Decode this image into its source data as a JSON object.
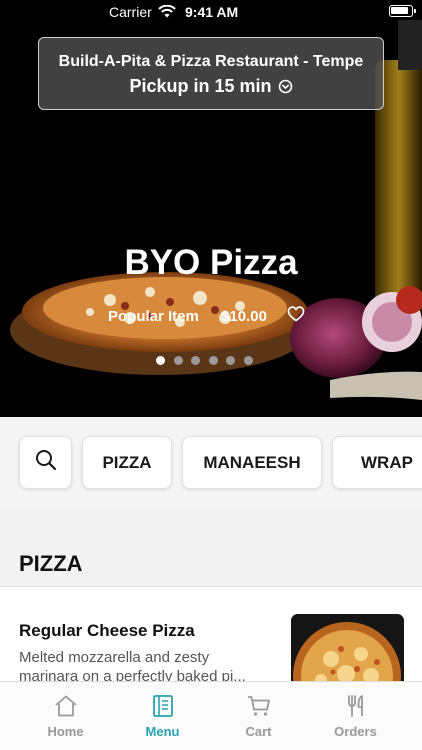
{
  "status_bar": {
    "carrier": "Carrier",
    "time": "9:41 AM"
  },
  "pickup": {
    "restaurant": "Build-A-Pita & Pizza Restaurant - Tempe",
    "time_label": "Pickup in 15 min"
  },
  "hero": {
    "title": "BYO Pizza",
    "badge": "Popular Item",
    "price": "$10.00",
    "slides": 6,
    "active_slide": 1
  },
  "chips": {
    "search_icon": "search-icon",
    "items": [
      "PIZZA",
      "MANAEESH",
      "WRAP"
    ]
  },
  "section": {
    "title": "PIZZA"
  },
  "item": {
    "name": "Regular Cheese Pizza",
    "description": "Melted mozzarella and zesty marinara on a perfectly baked pi..."
  },
  "tabbar": {
    "tabs": [
      {
        "label": "Home",
        "icon": "home-icon"
      },
      {
        "label": "Menu",
        "icon": "menu-icon"
      },
      {
        "label": "Cart",
        "icon": "cart-icon"
      },
      {
        "label": "Orders",
        "icon": "orders-icon"
      }
    ],
    "active": "Menu"
  },
  "colors": {
    "accent": "#29a3b0",
    "inactive": "#999999"
  }
}
